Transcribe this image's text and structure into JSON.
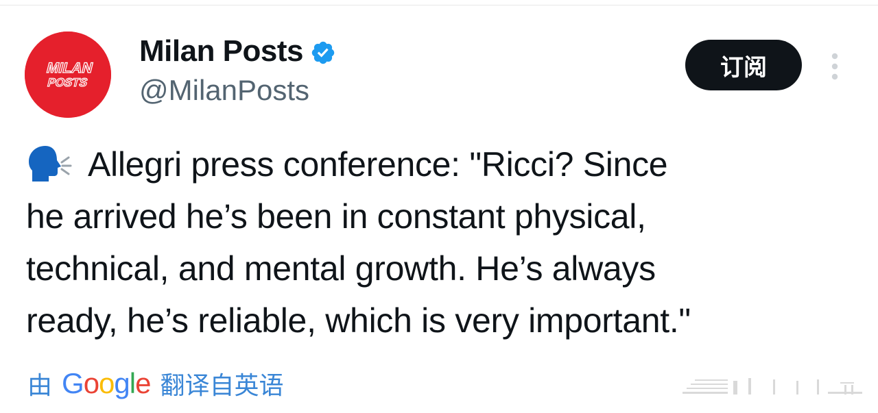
{
  "tweet": {
    "author": {
      "display_name": "Milan Posts",
      "handle": "@MilanPosts",
      "avatar_text_line1": "MILAN",
      "avatar_text_line2": "POSTS",
      "avatar_color": "#e5202c",
      "verified": true,
      "verified_icon": "verified-badge-icon"
    },
    "subscribe_label": "订阅",
    "more_icon": "more-vertical-icon",
    "speaker_icon": "speaking-head-icon",
    "text_lines": [
      "Allegri press conference: \"Ricci? Since",
      "he arrived he’s been in constant physical,",
      "technical, and mental growth. He’s always",
      "ready, he’s reliable, which is very important.\""
    ],
    "translation": {
      "prefix": "由",
      "provider": "Google",
      "suffix": "翻译自英语"
    }
  },
  "colors": {
    "text": "#0f1419",
    "secondary_text": "#536471",
    "verified_blue": "#1d9bf0",
    "button_bg": "#0f1419"
  }
}
